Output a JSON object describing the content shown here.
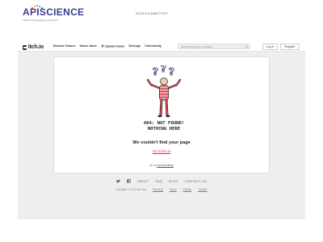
{
  "banner": {
    "logo_part1": "API",
    "logo_part2": "SCIENCE",
    "logo_tagline": "Abstract Pedagogique Innovante",
    "link": "SCALEGAMETEST"
  },
  "nav": {
    "brand": "itch.io",
    "links": [
      "Browse Games",
      "Game Jams",
      "Upload Game",
      "Devlogs",
      "Community"
    ],
    "search_placeholder": "Search for games or creators",
    "login": "Log in",
    "register": "Register"
  },
  "error": {
    "art_caption_line1": "404: NOT FOUND!",
    "art_caption_line2": "NOTHING HERE",
    "title": "We couldn't find your page",
    "link": "Go to itch.io",
    "credit_prefix": "Art by",
    "credit_author": "Ivan Bondaray"
  },
  "footer": {
    "links": [
      "ABOUT",
      "FAQ",
      "BLOG",
      "CONTACT US"
    ],
    "copyright": "Copyright © 2024 itch corp",
    "small_links": [
      "Directory",
      "Terms",
      "Privacy",
      "Cookies"
    ],
    "icons": [
      "twitter-icon",
      "facebook-icon"
    ]
  },
  "colors": {
    "accent": "#da2c38",
    "page_bg": "#eeeeee",
    "logo_blue": "#3a3f8f"
  }
}
